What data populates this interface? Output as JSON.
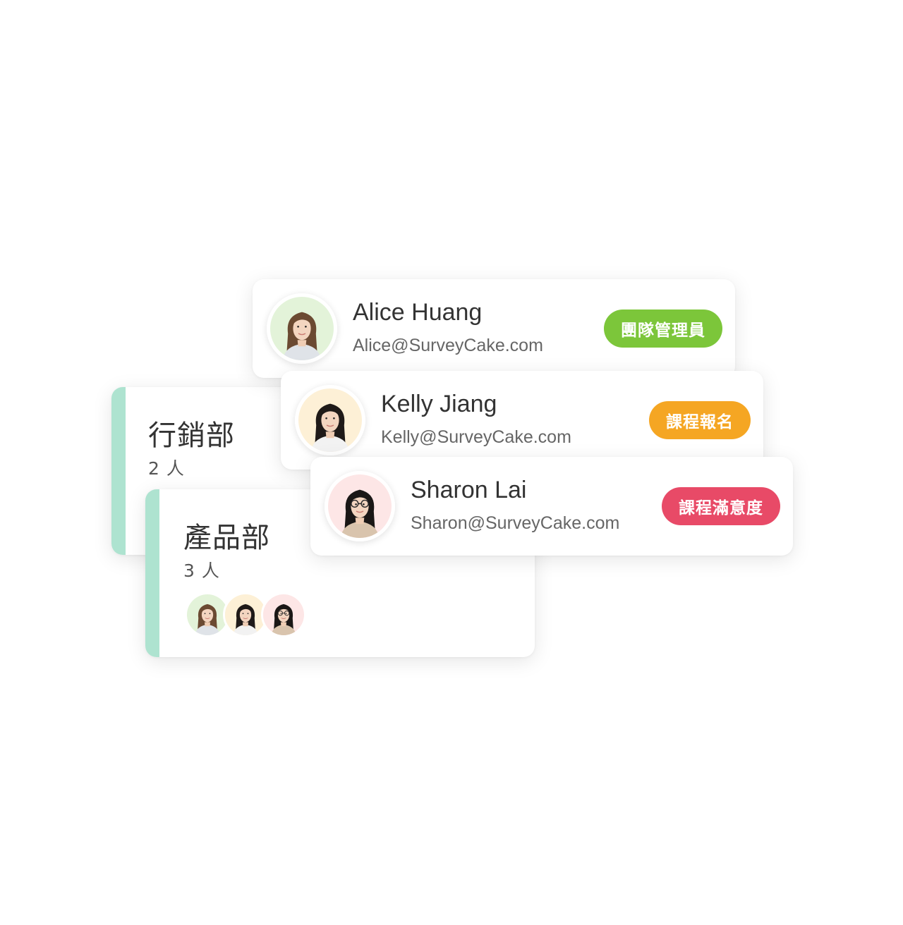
{
  "departments": [
    {
      "name": "行銷部",
      "count": "2 人",
      "accent_color": "#aee3d0"
    },
    {
      "name": "產品部",
      "count": "3 人",
      "accent_color": "#aee3d0",
      "member_avatars": [
        "alice-avatar",
        "kelly-avatar",
        "sharon-avatar"
      ]
    }
  ],
  "members": [
    {
      "name": "Alice Huang",
      "email": "Alice@SurveyCake.com",
      "role": "團隊管理員",
      "badge_color": "#7cc63a",
      "avatar_bg": "#e3f3d9"
    },
    {
      "name": "Kelly Jiang",
      "email": "Kelly@SurveyCake.com",
      "role": "課程報名",
      "badge_color": "#f5a623",
      "avatar_bg": "#fdf0d6"
    },
    {
      "name": "Sharon Lai",
      "email": "Sharon@SurveyCake.com",
      "role": "課程滿意度",
      "badge_color": "#e84a67",
      "avatar_bg": "#fde6e6"
    }
  ]
}
